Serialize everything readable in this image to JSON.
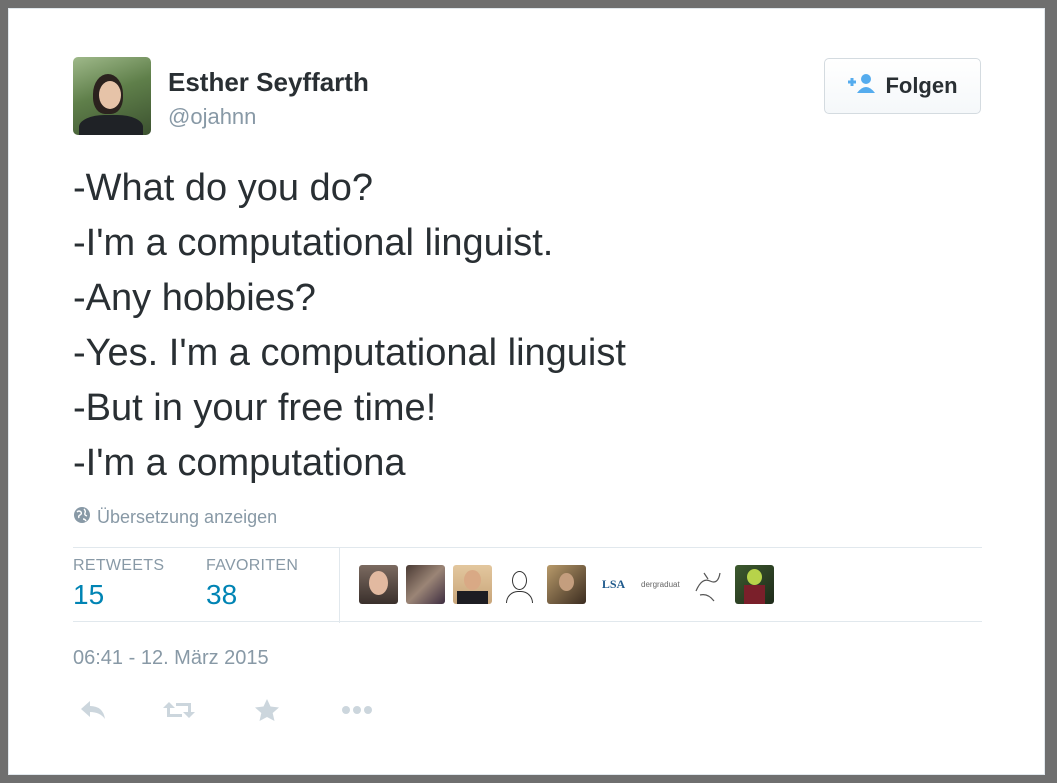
{
  "user": {
    "name": "Esther Seyffarth",
    "handle": "@ojahnn"
  },
  "follow_button": {
    "label": "Folgen",
    "icon": "add-user-icon"
  },
  "tweet": {
    "lines": [
      "-What do you do?",
      "-I'm a computational linguist.",
      "-Any hobbies?",
      "-Yes. I'm a computational linguist",
      "-But in your free time!",
      "-I'm a computationa"
    ]
  },
  "translate": {
    "label": "Übersetzung anzeigen",
    "icon": "globe-icon"
  },
  "stats": {
    "retweets_label": "RETWEETS",
    "retweets_value": "15",
    "favorites_label": "FAVORITEN",
    "favorites_value": "38"
  },
  "favoriters": [
    {
      "name": "favoriter-avatar-1"
    },
    {
      "name": "favoriter-avatar-2"
    },
    {
      "name": "favoriter-avatar-3"
    },
    {
      "name": "favoriter-avatar-4"
    },
    {
      "name": "favoriter-avatar-5"
    },
    {
      "name": "favoriter-avatar-6",
      "text": "LSA"
    },
    {
      "name": "favoriter-avatar-7",
      "text": "dergraduat"
    },
    {
      "name": "favoriter-avatar-8"
    },
    {
      "name": "favoriter-avatar-9"
    }
  ],
  "timestamp": "06:41 - 12. März 2015",
  "actions": [
    "reply-icon",
    "retweet-icon",
    "favorite-star-icon",
    "more-icon"
  ],
  "colors": {
    "text": "#292f33",
    "muted": "#8899a6",
    "link": "#0084b4",
    "follow_icon": "#55acee",
    "action_icon": "#ccd6dd"
  }
}
